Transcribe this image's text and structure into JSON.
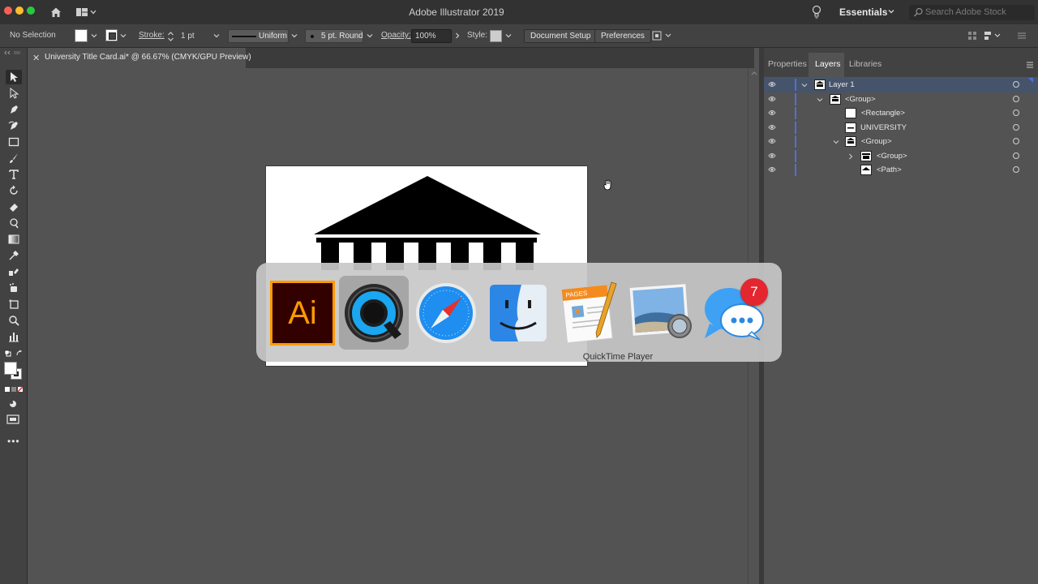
{
  "window": {
    "title": "Adobe Illustrator 2019"
  },
  "workspace": {
    "name": "Essentials",
    "search_placeholder": "Search Adobe Stock"
  },
  "controlbar": {
    "selection": "No Selection",
    "stroke_label": "Stroke:",
    "stroke_weight": "1 pt",
    "stroke_profile": "Uniform",
    "brush": "5 pt. Round",
    "opacity_label": "Opacity:",
    "opacity_value": "100%",
    "style_label": "Style:",
    "document_setup": "Document Setup",
    "preferences": "Preferences"
  },
  "document_tab": {
    "title": "University Title Card.ai* @ 66.67% (CMYK/GPU Preview)"
  },
  "panel": {
    "tabs": [
      "Properties",
      "Layers",
      "Libraries"
    ],
    "active_tab": "Layers",
    "layers": [
      {
        "name": "Layer 1",
        "depth": 0,
        "expanded": true,
        "selected": true
      },
      {
        "name": "<Group>",
        "depth": 1,
        "expanded": true,
        "selected": false
      },
      {
        "name": "<Rectangle>",
        "depth": 2,
        "expanded": false,
        "selected": false
      },
      {
        "name": "UNIVERSITY",
        "depth": 2,
        "expanded": false,
        "selected": false
      },
      {
        "name": "<Group>",
        "depth": 2,
        "expanded": true,
        "selected": false
      },
      {
        "name": "<Group>",
        "depth": 3,
        "expanded": false,
        "selected": false
      },
      {
        "name": "<Path>",
        "depth": 3,
        "expanded": false,
        "selected": false
      }
    ]
  },
  "app_switcher": {
    "selected_label": "QuickTime Player",
    "apps": [
      {
        "name": "Adobe Illustrator",
        "icon": "illustrator-icon"
      },
      {
        "name": "QuickTime Player",
        "icon": "quicktime-icon"
      },
      {
        "name": "Safari",
        "icon": "safari-icon"
      },
      {
        "name": "Finder",
        "icon": "finder-icon"
      },
      {
        "name": "Pages",
        "icon": "pages-icon"
      },
      {
        "name": "Preview",
        "icon": "preview-icon"
      },
      {
        "name": "Messages",
        "icon": "messages-icon"
      }
    ],
    "illustrator_text": "Ai",
    "pages_text": "PAGES",
    "messages_badge": "7"
  },
  "colors": {
    "accent": "#4f70d9",
    "selection_row": "#46546b",
    "badge": "#e3262f"
  }
}
